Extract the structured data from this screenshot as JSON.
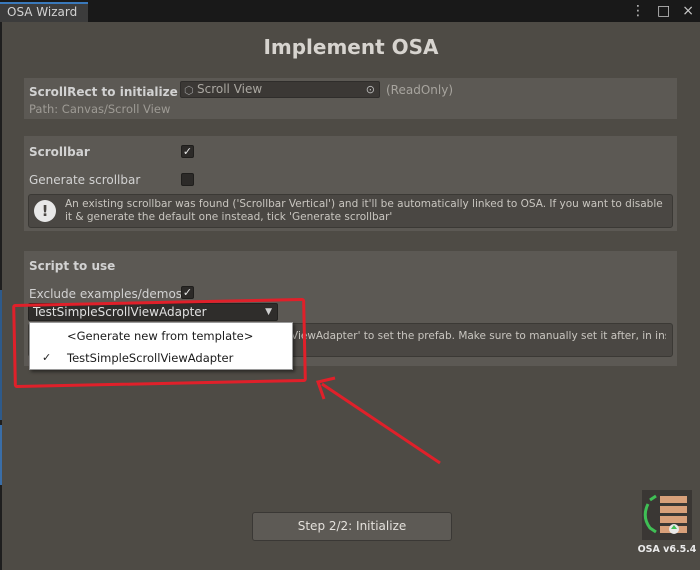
{
  "tab": {
    "title": "OSA Wizard"
  },
  "window": {
    "title": "Implement OSA"
  },
  "scrollrect": {
    "label": "ScrollRect to initialize",
    "field_value": "Scroll View",
    "readonly": "(ReadOnly)",
    "path": "Path: Canvas/Scroll View"
  },
  "scrollbar": {
    "label": "Scrollbar",
    "checked": "✓",
    "generate_label": "Generate scrollbar",
    "help": "An existing scrollbar was found ('Scrollbar Vertical') and it'll be automatically linked to OSA. If you want to disable it & generate the default one instead, tick 'Generate scrollbar'"
  },
  "script": {
    "label": "Script to use",
    "exclude_label": "Exclude examples/demos",
    "exclude_checked": "✓",
    "selected": "TestSimpleScrollViewAdapter",
    "help_fragment": "ViewAdapter' to set the prefab. Make sure to manually set it after, in inspector",
    "options": [
      {
        "label": "<Generate new from template>",
        "check": ""
      },
      {
        "label": "TestSimpleScrollViewAdapter",
        "check": "✓"
      }
    ]
  },
  "initialize_button": "Step 2/2: Initialize",
  "version": "OSA v6.5.4",
  "icons": [
    "kebab-menu-icon",
    "maximize-icon",
    "close-icon",
    "gameobject-icon",
    "object-picker-icon",
    "info-icon",
    "dropdown-arrow-icon",
    "checkmark-icon",
    "osa-logo-icon"
  ],
  "annotation": {
    "color": "#e0202a"
  }
}
